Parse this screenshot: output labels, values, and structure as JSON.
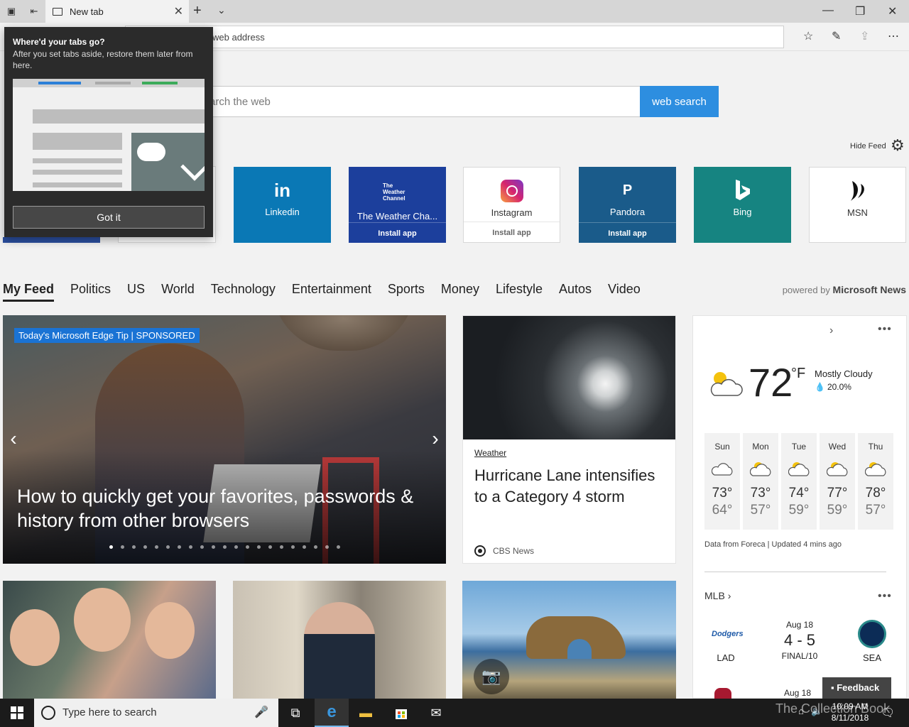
{
  "browser": {
    "tab_title": "New tab",
    "address_placeholder": "Search or enter web address",
    "address_visible": "web address"
  },
  "search": {
    "placeholder_visible": "arch the web",
    "button_label": "web search"
  },
  "hide_feed": "Hide Feed",
  "tiles": [
    {
      "name": "Linkedin",
      "logo": "in",
      "install": "",
      "color": "#0a78b5"
    },
    {
      "name": "The Weather Cha...",
      "logo": "The Weather Channel",
      "install": "Install app",
      "color": "#1c3f9c"
    },
    {
      "name": "Instagram",
      "logo": "instagram-icon",
      "install": "Install app",
      "color": "#ffffff"
    },
    {
      "name": "Pandora",
      "logo": "P",
      "install": "Install app",
      "color": "#1a5b8a"
    },
    {
      "name": "Bing",
      "logo": "bing-icon",
      "install": "",
      "color": "#168481"
    },
    {
      "name": "MSN",
      "logo": "msn-icon",
      "install": "",
      "color": "#ffffff"
    }
  ],
  "feed_nav": [
    "My Feed",
    "Politics",
    "US",
    "World",
    "Technology",
    "Entertainment",
    "Sports",
    "Money",
    "Lifestyle",
    "Autos",
    "Video"
  ],
  "powered_by": {
    "prefix": "powered by",
    "brand": "Microsoft News"
  },
  "hero": {
    "badge": "Today's Microsoft Edge Tip | SPONSORED",
    "title": "How to quickly get your favorites, passwords & history from other browsers",
    "slides": 21,
    "active_slide": 1
  },
  "hurricane": {
    "category": "Weather",
    "title": "Hurricane Lane intensifies to a Category 4 storm",
    "source": "CBS News"
  },
  "weather": {
    "temp": "72",
    "unit": "°F",
    "condition": "Mostly Cloudy",
    "precip": "20.0%",
    "forecast": [
      {
        "day": "Sun",
        "hi": "73°",
        "lo": "64°",
        "icon": "cloud-icon"
      },
      {
        "day": "Mon",
        "hi": "73°",
        "lo": "57°",
        "icon": "partly-sunny-icon"
      },
      {
        "day": "Tue",
        "hi": "74°",
        "lo": "59°",
        "icon": "partly-sunny-icon"
      },
      {
        "day": "Wed",
        "hi": "77°",
        "lo": "59°",
        "icon": "partly-sunny-icon"
      },
      {
        "day": "Thu",
        "hi": "78°",
        "lo": "57°",
        "icon": "partly-sunny-icon"
      }
    ],
    "data_source": "Data from Foreca | Updated 4 mins ago"
  },
  "mlb": {
    "label": "MLB",
    "game": {
      "date": "Aug 18",
      "score": "4 - 5",
      "status": "FINAL/10",
      "home": "LAD",
      "away": "SEA"
    },
    "next_date": "Aug 18"
  },
  "feedback": "Feedback",
  "popup": {
    "title": "Where'd your tabs go?",
    "description": "After you set tabs aside, restore them later from here.",
    "button": "Got it"
  },
  "taskbar": {
    "search_placeholder": "Type here to search",
    "time": "10:09 AM",
    "date": "8/11/2018",
    "watermark": "The Collection Book"
  }
}
